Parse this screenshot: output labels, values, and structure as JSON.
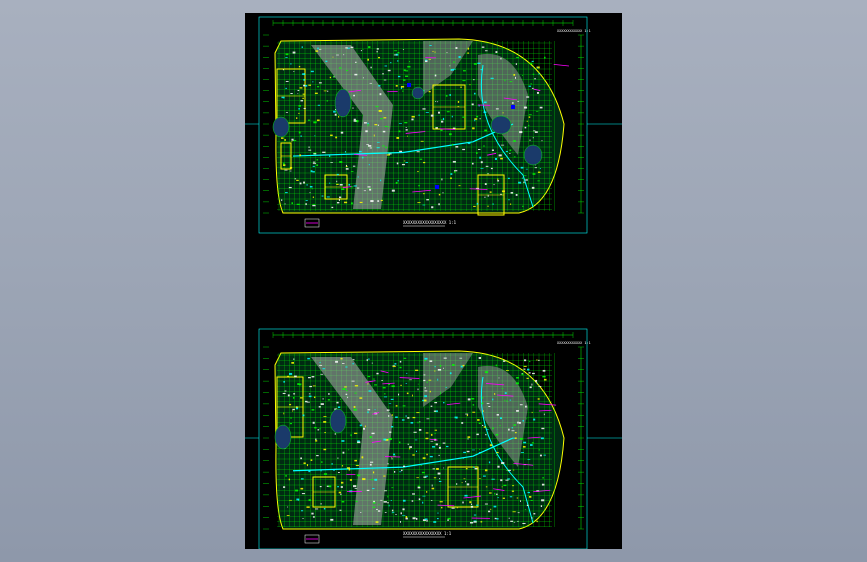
{
  "viewer": {
    "background_top": "#a8b0bf",
    "background_bottom": "#8e98aa",
    "sheet_color": "#000000"
  },
  "colors": {
    "grid": "#00ff00",
    "walls": "#00ffff",
    "rooms": "#ffff00",
    "hatch": "#b0b0b0",
    "accent": "#ff00ff",
    "note": "#ffffff",
    "water": "#0000ff",
    "dark": "#1a3a6a"
  },
  "plans": [
    {
      "id": "upper-plan",
      "caption": "XXXXXXXXXXXXXXXXXX 1:1",
      "title_tag": "XXXXXXXXXXXX 1:1"
    },
    {
      "id": "lower-plan",
      "caption": "XXXXXXXXXXXXXXXX 1:1",
      "title_tag": "XXXXXXXXXXXX 1:1"
    }
  ]
}
